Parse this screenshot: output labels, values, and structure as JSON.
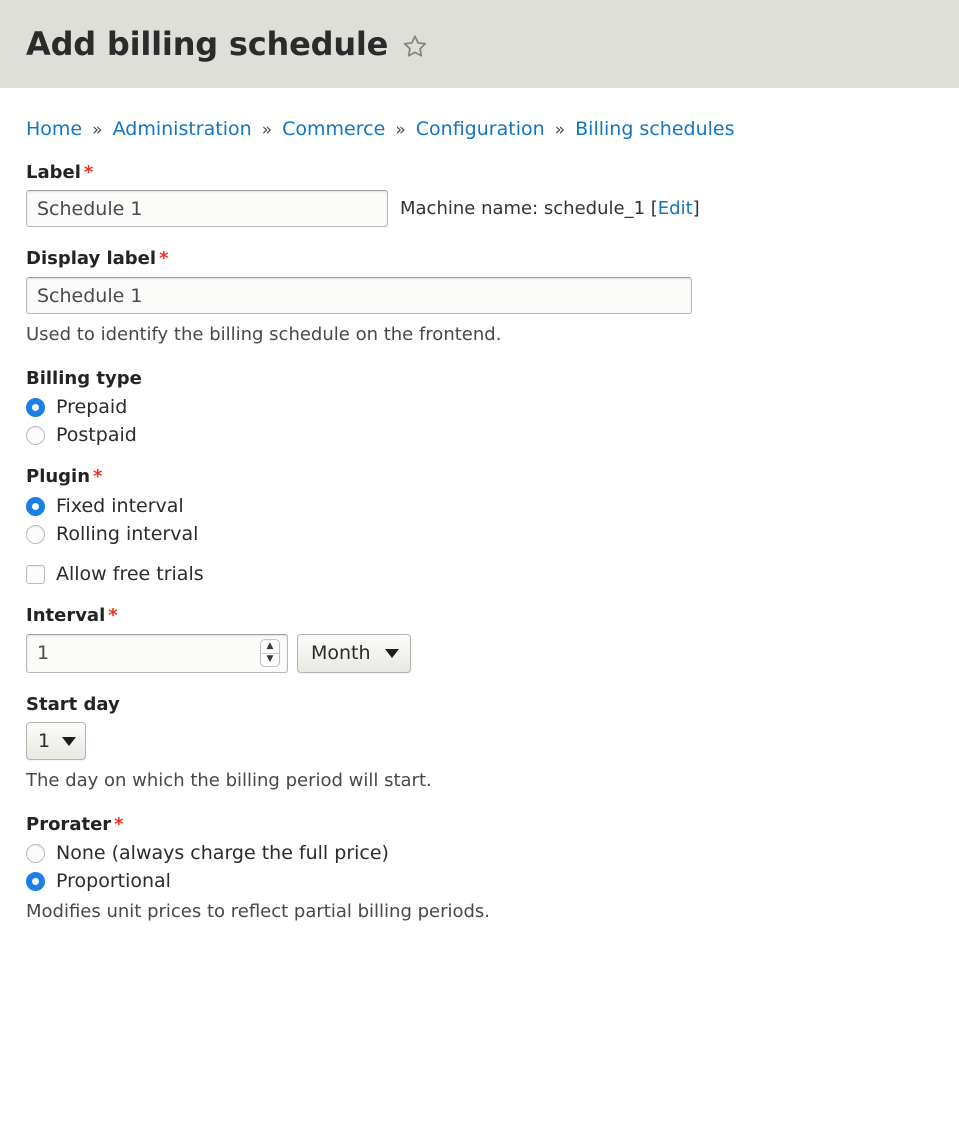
{
  "header": {
    "title": "Add billing schedule",
    "star_icon": "star-outline-icon"
  },
  "breadcrumb": {
    "separator": "»",
    "items": [
      {
        "label": "Home"
      },
      {
        "label": "Administration"
      },
      {
        "label": "Commerce"
      },
      {
        "label": "Configuration"
      },
      {
        "label": "Billing schedules"
      }
    ]
  },
  "form": {
    "label_field": {
      "label": "Label",
      "required_marker": "*",
      "value": "Schedule 1",
      "machine_name_prefix": "Machine name: schedule_1 [",
      "machine_name_edit": "Edit",
      "machine_name_suffix": "]"
    },
    "display_label_field": {
      "label": "Display label",
      "required_marker": "*",
      "value": "Schedule 1",
      "description": "Used to identify the billing schedule on the frontend."
    },
    "billing_type": {
      "label": "Billing type",
      "options": [
        {
          "label": "Prepaid",
          "selected": true
        },
        {
          "label": "Postpaid",
          "selected": false
        }
      ]
    },
    "plugin": {
      "label": "Plugin",
      "required_marker": "*",
      "options": [
        {
          "label": "Fixed interval",
          "selected": true
        },
        {
          "label": "Rolling interval",
          "selected": false
        }
      ]
    },
    "allow_free_trials": {
      "label": "Allow free trials",
      "checked": false
    },
    "interval": {
      "label": "Interval",
      "required_marker": "*",
      "value": "1",
      "unit": "Month"
    },
    "start_day": {
      "label": "Start day",
      "value": "1",
      "description": "The day on which the billing period will start."
    },
    "prorater": {
      "label": "Prorater",
      "required_marker": "*",
      "options": [
        {
          "label": "None (always charge the full price)",
          "selected": false
        },
        {
          "label": "Proportional",
          "selected": true
        }
      ],
      "description": "Modifies unit prices to reflect partial billing periods."
    }
  },
  "colors": {
    "header_bg": "#dedfd9",
    "link": "#1275c4",
    "required": "#ee3322",
    "radio_selected": "#1b7fe8"
  }
}
